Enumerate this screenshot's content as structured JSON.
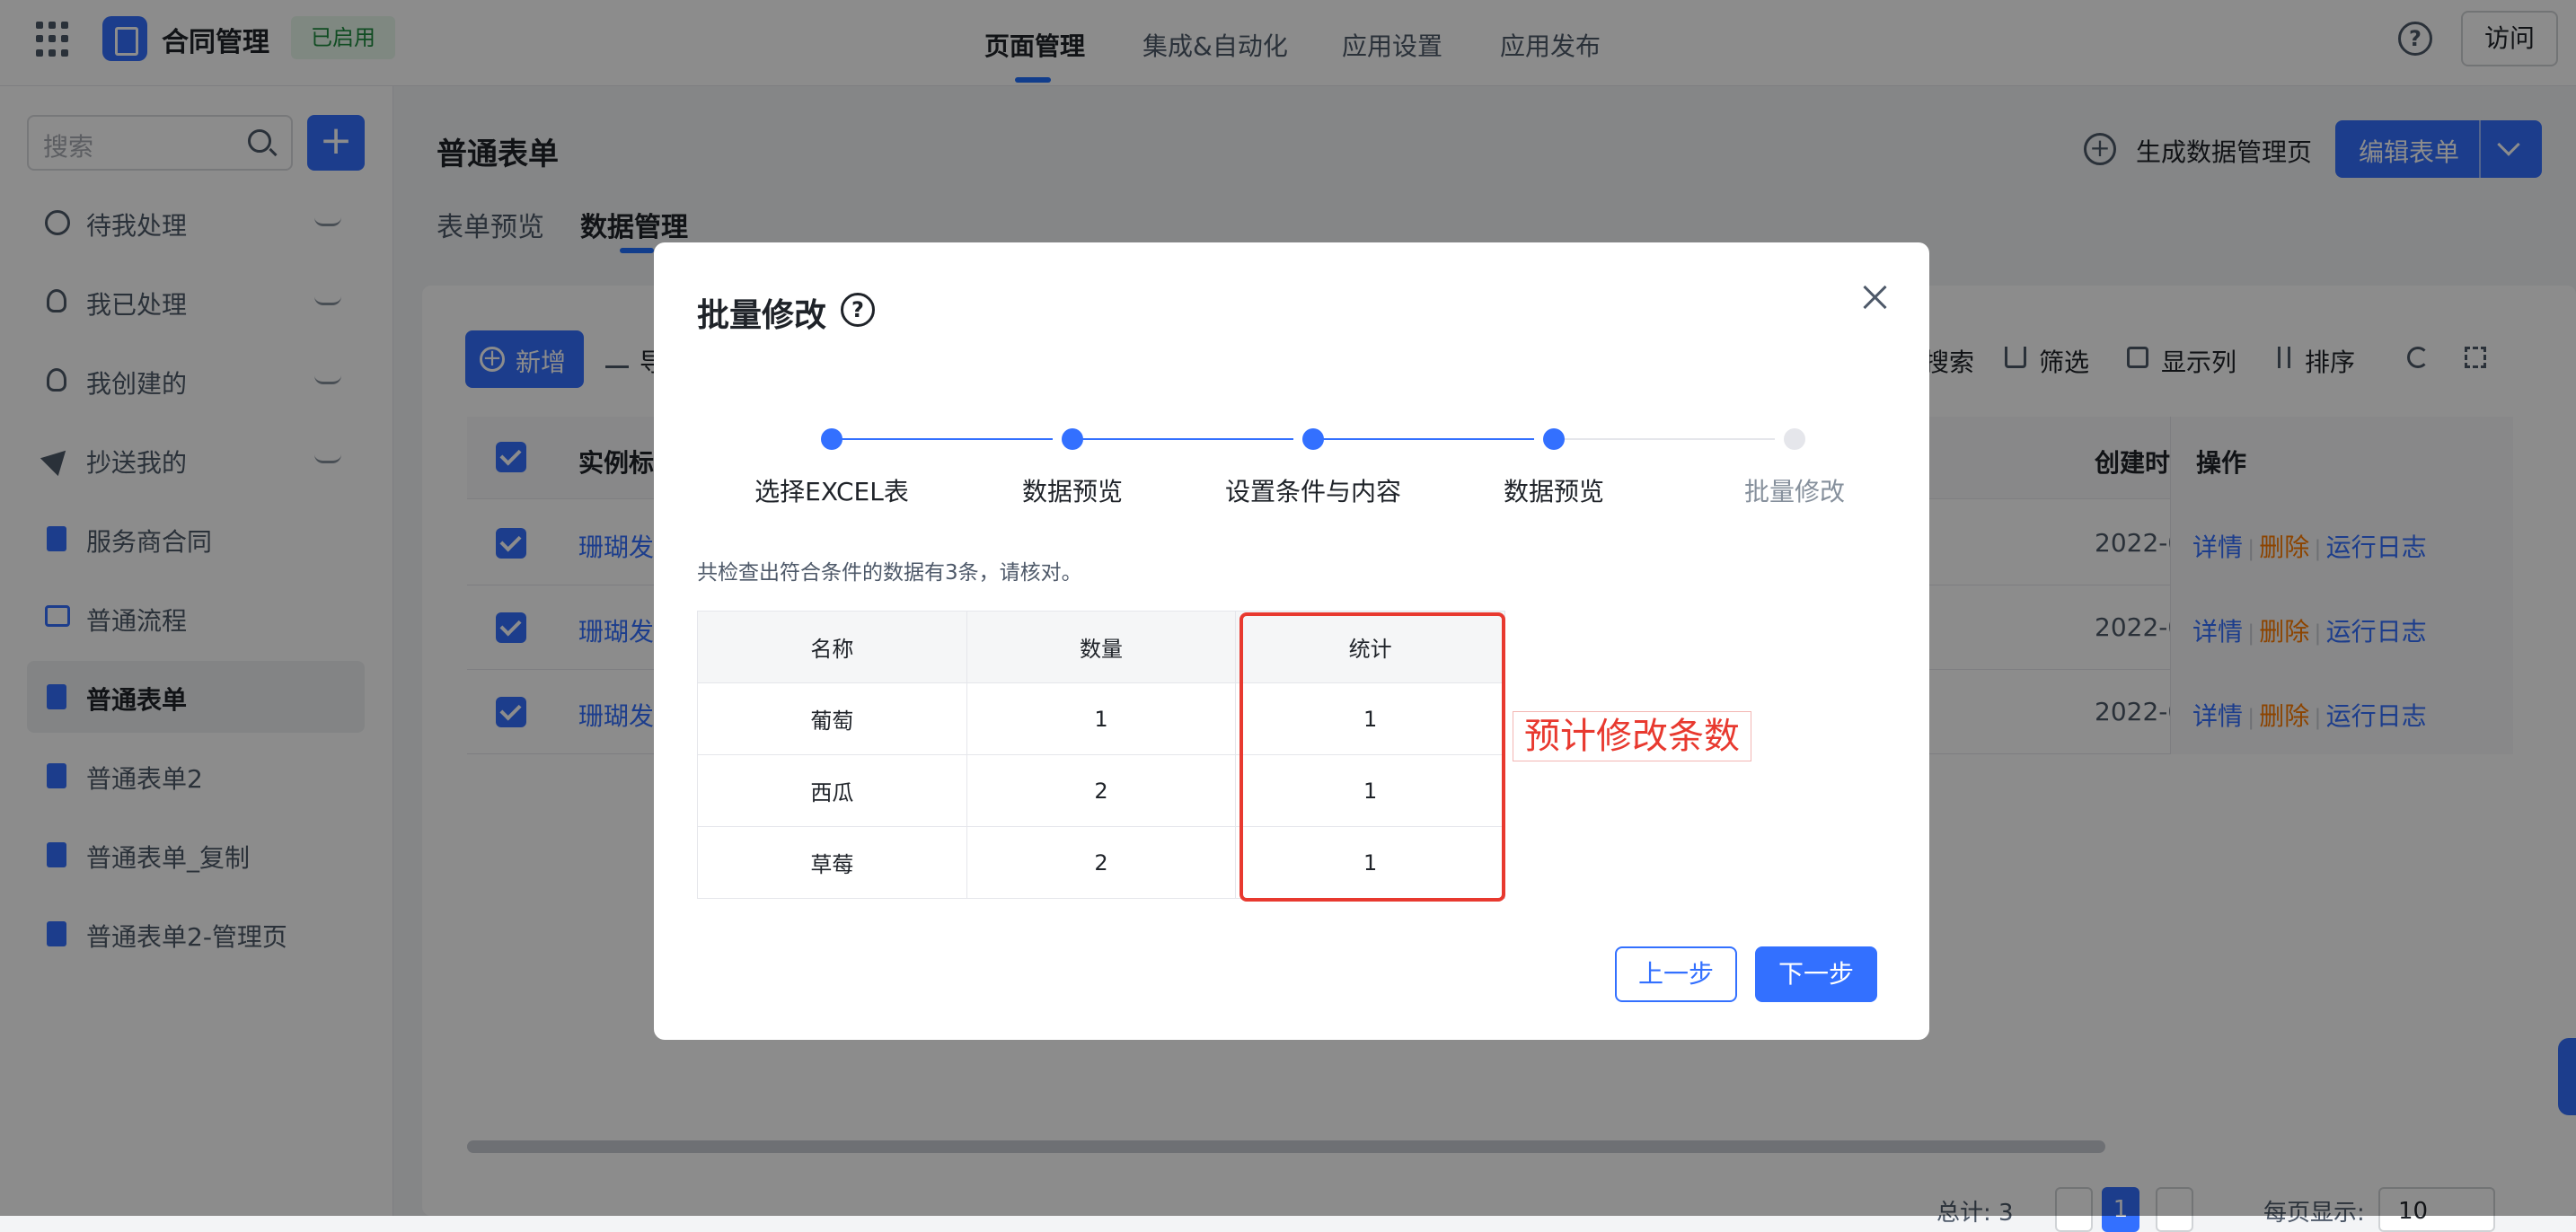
{
  "topbar": {
    "app_title": "合同管理",
    "app_badge": "已启用",
    "nav_tabs": [
      "页面管理",
      "集成&自动化",
      "应用设置",
      "应用发布"
    ],
    "visit": "访问",
    "help": "?"
  },
  "sidebar": {
    "search_placeholder": "搜索",
    "add": "+",
    "items": [
      {
        "label": "待我处理",
        "icon": "clock-icon"
      },
      {
        "label": "我已处理",
        "icon": "user-check-icon"
      },
      {
        "label": "我创建的",
        "icon": "user-icon"
      },
      {
        "label": "抄送我的",
        "icon": "send-icon"
      },
      {
        "label": "服务商合同",
        "icon": "doc-icon"
      },
      {
        "label": "普通流程",
        "icon": "flow-icon"
      },
      {
        "label": "普通表单",
        "icon": "doc-icon"
      },
      {
        "label": "普通表单2",
        "icon": "doc-icon"
      },
      {
        "label": "普通表单_复制",
        "icon": "doc-icon"
      },
      {
        "label": "普通表单2-管理页",
        "icon": "doc-icon"
      }
    ]
  },
  "main": {
    "title": "普通表单",
    "tabs": [
      "表单预览",
      "数据管理"
    ],
    "gen_page": "生成数据管理页",
    "edit_form": "编辑表单",
    "new": "新增",
    "import": "导",
    "tools": [
      "搜索",
      "筛选",
      "显示列",
      "排序"
    ],
    "columns": [
      "实例标",
      "创建时",
      "操作"
    ],
    "rows": [
      {
        "title": "珊瑚发",
        "date": "2022-0"
      },
      {
        "title": "珊瑚发",
        "date": "2022-0"
      },
      {
        "title": "珊瑚发",
        "date": "2022-0"
      }
    ],
    "actions": {
      "detail": "详情",
      "delete": "删除",
      "log": "运行日志",
      "sep": "|"
    },
    "pager": {
      "total": "总计: 3",
      "current": "1",
      "size_label": "每页显示:",
      "size": "10"
    }
  },
  "modal": {
    "title": "批量修改",
    "help": "?",
    "steps": [
      {
        "label": "选择EXCEL表",
        "done": true
      },
      {
        "label": "数据预览",
        "done": true
      },
      {
        "label": "设置条件与内容",
        "done": true
      },
      {
        "label": "数据预览",
        "done": true
      },
      {
        "label": "批量修改",
        "done": false
      }
    ],
    "hint": "共检查出符合条件的数据有3条，请核对。",
    "table": {
      "headers": [
        "名称",
        "数量",
        "统计"
      ],
      "rows": [
        [
          "葡萄",
          "1",
          "1"
        ],
        [
          "西瓜",
          "2",
          "1"
        ],
        [
          "草莓",
          "2",
          "1"
        ]
      ]
    },
    "annotation": "预计修改条数",
    "prev": "上一步",
    "next": "下一步"
  },
  "colors": {
    "primary": "#3370ff",
    "danger": "#e8392f",
    "delete_action": "#ff7d00",
    "badge_green": "#1e8b3f"
  }
}
